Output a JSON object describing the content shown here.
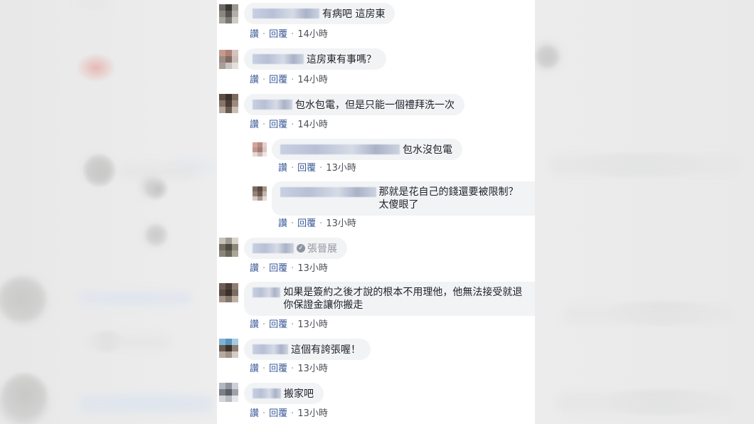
{
  "actions": {
    "like": "讚",
    "reply": "回覆",
    "separator": "·"
  },
  "comments": [
    {
      "text": "有病吧 這房東",
      "time": "14小時"
    },
    {
      "text": "這房東有事嗎？",
      "time": "14小時"
    },
    {
      "text": "包水包電，但是只能一個禮拜洗一次",
      "time": "14小時"
    },
    {
      "text": "包水沒包電",
      "time": "13小時",
      "reply": true
    },
    {
      "text": "那就是花自己的錢還要被限制？太傻眼了",
      "time": "13小時",
      "reply": true
    },
    {
      "text": "張晉展",
      "time": "13小時",
      "mention": true,
      "mention_icon": "tag-icon"
    },
    {
      "text": "如果是簽約之後才說的根本不用理他，他無法接受就退你保證金讓你搬走",
      "time": "13小時"
    },
    {
      "text": "這個有誇張喔！",
      "time": "13小時"
    },
    {
      "text": "搬家吧",
      "time": "13小時"
    }
  ]
}
